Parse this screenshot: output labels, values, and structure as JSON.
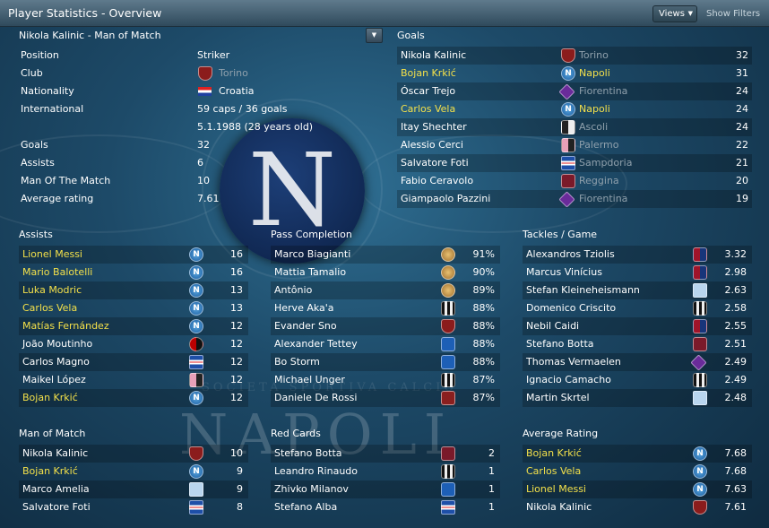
{
  "window": {
    "title": "Player Statistics - Overview",
    "views_label": "Views",
    "show_filters_label": "Show Filters"
  },
  "selector": {
    "label": "Nikola Kalinic - Man of Match"
  },
  "background": {
    "club_name": "NAPOLI",
    "motto": "SOCIETA SPORTIVA CALCIO"
  },
  "player": {
    "rows": [
      {
        "label": "Position",
        "value": "Striker"
      },
      {
        "label": "Club",
        "value": "Torino",
        "badge": "torino"
      },
      {
        "label": "Nationality",
        "value": "Croatia",
        "flag": "croatia"
      },
      {
        "label": "International",
        "value": "59 caps / 36 goals"
      },
      {
        "label": "",
        "value": "5.1.1988 (28 years old)"
      },
      {
        "label": "Goals",
        "value": "32"
      },
      {
        "label": "Assists",
        "value": "6"
      },
      {
        "label": "Man Of The Match",
        "value": "10"
      },
      {
        "label": "Average rating",
        "value": "7.61"
      }
    ]
  },
  "goals": {
    "title": "Goals",
    "rows": [
      {
        "name": "Nikola Kalinic",
        "club": "Torino",
        "badge": "torino",
        "value": "32",
        "highlight": false
      },
      {
        "name": "Bojan Krkić",
        "club": "Napoli",
        "badge": "napoli",
        "value": "31",
        "highlight": true
      },
      {
        "name": "Óscar Trejo",
        "club": "Fiorentina",
        "badge": "fiorentina",
        "value": "24",
        "highlight": false
      },
      {
        "name": "Carlos Vela",
        "club": "Napoli",
        "badge": "napoli",
        "value": "24",
        "highlight": true
      },
      {
        "name": "Itay Shechter",
        "club": "Ascoli",
        "badge": "ascoli",
        "value": "24",
        "highlight": false
      },
      {
        "name": "Alessio Cerci",
        "club": "Palermo",
        "badge": "palermo",
        "value": "22",
        "highlight": false
      },
      {
        "name": "Salvatore Foti",
        "club": "Sampdoria",
        "badge": "sampdoria",
        "value": "21",
        "highlight": false
      },
      {
        "name": "Fabio Ceravolo",
        "club": "Reggina",
        "badge": "reggina",
        "value": "20",
        "highlight": false
      },
      {
        "name": "Giampaolo Pazzini",
        "club": "Fiorentina",
        "badge": "fiorentina",
        "value": "19",
        "highlight": false
      }
    ]
  },
  "assists": {
    "title": "Assists",
    "rows": [
      {
        "name": "Lionel Messi",
        "badge": "napoli",
        "value": "16",
        "highlight": true
      },
      {
        "name": "Mario Balotelli",
        "badge": "napoli",
        "value": "16",
        "highlight": true
      },
      {
        "name": "Luka Modric",
        "badge": "napoli",
        "value": "13",
        "highlight": true
      },
      {
        "name": "Carlos Vela",
        "badge": "napoli",
        "value": "13",
        "highlight": true
      },
      {
        "name": "Matías Fernández",
        "badge": "napoli",
        "value": "12",
        "highlight": true
      },
      {
        "name": "João Moutinho",
        "badge": "milan",
        "value": "12",
        "highlight": false
      },
      {
        "name": "Carlos Magno",
        "badge": "sampdoria",
        "value": "12",
        "highlight": false
      },
      {
        "name": "Maikel López",
        "badge": "palermo",
        "value": "12",
        "highlight": false
      },
      {
        "name": "Bojan Krkić",
        "badge": "napoli",
        "value": "12",
        "highlight": true
      }
    ]
  },
  "pass_completion": {
    "title": "Pass Completion",
    "rows": [
      {
        "name": "Marco Biagianti",
        "badge": "mug",
        "value": "91%"
      },
      {
        "name": "Mattia Tamalio",
        "badge": "mug",
        "value": "90%"
      },
      {
        "name": "Antônio",
        "badge": "mug",
        "value": "89%"
      },
      {
        "name": "Herve Aka'a",
        "badge": "juve",
        "value": "88%"
      },
      {
        "name": "Evander Sno",
        "badge": "torino",
        "value": "88%"
      },
      {
        "name": "Alexander Tettey",
        "badge": "empoli",
        "value": "88%"
      },
      {
        "name": "Bo Storm",
        "badge": "empoli",
        "value": "88%"
      },
      {
        "name": "Michael Unger",
        "badge": "juve",
        "value": "87%"
      },
      {
        "name": "Daniele De Rossi",
        "badge": "roma",
        "value": "87%"
      }
    ]
  },
  "tackles": {
    "title": "Tackles / Game",
    "rows": [
      {
        "name": "Alexandros Tziolis",
        "badge": "cagliari",
        "value": "3.32"
      },
      {
        "name": "Marcus Vinícius",
        "badge": "cagliari",
        "value": "2.98"
      },
      {
        "name": "Stefan Kleineheismann",
        "badge": "lazio",
        "value": "2.63"
      },
      {
        "name": "Domenico Criscito",
        "badge": "juve",
        "value": "2.58"
      },
      {
        "name": "Nebil Caidi",
        "badge": "cagliari",
        "value": "2.55"
      },
      {
        "name": "Stefano Botta",
        "badge": "reggina",
        "value": "2.51"
      },
      {
        "name": "Thomas Vermaelen",
        "badge": "fiorentina",
        "value": "2.49"
      },
      {
        "name": "Ignacio Camacho",
        "badge": "juve",
        "value": "2.49"
      },
      {
        "name": "Martin Skrtel",
        "badge": "lazio",
        "value": "2.48"
      }
    ]
  },
  "man_of_match": {
    "title": "Man of Match",
    "rows": [
      {
        "name": "Nikola Kalinic",
        "badge": "torino",
        "value": "10",
        "highlight": false
      },
      {
        "name": "Bojan Krkić",
        "badge": "napoli",
        "value": "9",
        "highlight": true
      },
      {
        "name": "Marco Amelia",
        "badge": "lazio",
        "value": "9",
        "highlight": false
      },
      {
        "name": "Salvatore Foti",
        "badge": "sampdoria",
        "value": "8",
        "highlight": false
      }
    ]
  },
  "red_cards": {
    "title": "Red Cards",
    "rows": [
      {
        "name": "Stefano Botta",
        "badge": "reggina",
        "value": "2"
      },
      {
        "name": "Leandro Rinaudo",
        "badge": "juve",
        "value": "1"
      },
      {
        "name": "Zhivko Milanov",
        "badge": "empoli",
        "value": "1"
      },
      {
        "name": "Stefano Alba",
        "badge": "sampdoria",
        "value": "1"
      }
    ]
  },
  "average_rating": {
    "title": "Average Rating",
    "rows": [
      {
        "name": "Bojan Krkić",
        "badge": "napoli",
        "value": "7.68",
        "highlight": true
      },
      {
        "name": "Carlos Vela",
        "badge": "napoli",
        "value": "7.68",
        "highlight": true
      },
      {
        "name": "Lionel Messi",
        "badge": "napoli",
        "value": "7.63",
        "highlight": true
      },
      {
        "name": "Nikola Kalinic",
        "badge": "torino",
        "value": "7.61",
        "highlight": false
      }
    ]
  }
}
